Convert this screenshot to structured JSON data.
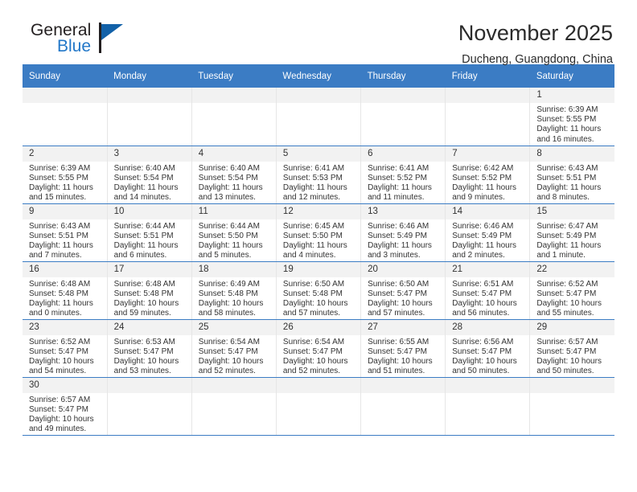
{
  "brand": {
    "name_top": "General",
    "name_bottom": "Blue",
    "flag_icon": "blue-triangle-flag-icon",
    "accent_color": "#2277c8"
  },
  "header": {
    "title": "November 2025",
    "subtitle": "Ducheng, Guangdong, China"
  },
  "theme": {
    "header_blue": "#3b7cc4",
    "row_border_blue": "#3b7cc4",
    "daynum_bg": "#f2f2f2"
  },
  "calendar": {
    "weekday_headers": [
      "Sunday",
      "Monday",
      "Tuesday",
      "Wednesday",
      "Thursday",
      "Friday",
      "Saturday"
    ],
    "weeks": [
      [
        {
          "day": ""
        },
        {
          "day": ""
        },
        {
          "day": ""
        },
        {
          "day": ""
        },
        {
          "day": ""
        },
        {
          "day": ""
        },
        {
          "day": "1",
          "sunrise": "Sunrise: 6:39 AM",
          "sunset": "Sunset: 5:55 PM",
          "daylight": "Daylight: 11 hours and 16 minutes."
        }
      ],
      [
        {
          "day": "2",
          "sunrise": "Sunrise: 6:39 AM",
          "sunset": "Sunset: 5:55 PM",
          "daylight": "Daylight: 11 hours and 15 minutes."
        },
        {
          "day": "3",
          "sunrise": "Sunrise: 6:40 AM",
          "sunset": "Sunset: 5:54 PM",
          "daylight": "Daylight: 11 hours and 14 minutes."
        },
        {
          "day": "4",
          "sunrise": "Sunrise: 6:40 AM",
          "sunset": "Sunset: 5:54 PM",
          "daylight": "Daylight: 11 hours and 13 minutes."
        },
        {
          "day": "5",
          "sunrise": "Sunrise: 6:41 AM",
          "sunset": "Sunset: 5:53 PM",
          "daylight": "Daylight: 11 hours and 12 minutes."
        },
        {
          "day": "6",
          "sunrise": "Sunrise: 6:41 AM",
          "sunset": "Sunset: 5:52 PM",
          "daylight": "Daylight: 11 hours and 11 minutes."
        },
        {
          "day": "7",
          "sunrise": "Sunrise: 6:42 AM",
          "sunset": "Sunset: 5:52 PM",
          "daylight": "Daylight: 11 hours and 9 minutes."
        },
        {
          "day": "8",
          "sunrise": "Sunrise: 6:43 AM",
          "sunset": "Sunset: 5:51 PM",
          "daylight": "Daylight: 11 hours and 8 minutes."
        }
      ],
      [
        {
          "day": "9",
          "sunrise": "Sunrise: 6:43 AM",
          "sunset": "Sunset: 5:51 PM",
          "daylight": "Daylight: 11 hours and 7 minutes."
        },
        {
          "day": "10",
          "sunrise": "Sunrise: 6:44 AM",
          "sunset": "Sunset: 5:51 PM",
          "daylight": "Daylight: 11 hours and 6 minutes."
        },
        {
          "day": "11",
          "sunrise": "Sunrise: 6:44 AM",
          "sunset": "Sunset: 5:50 PM",
          "daylight": "Daylight: 11 hours and 5 minutes."
        },
        {
          "day": "12",
          "sunrise": "Sunrise: 6:45 AM",
          "sunset": "Sunset: 5:50 PM",
          "daylight": "Daylight: 11 hours and 4 minutes."
        },
        {
          "day": "13",
          "sunrise": "Sunrise: 6:46 AM",
          "sunset": "Sunset: 5:49 PM",
          "daylight": "Daylight: 11 hours and 3 minutes."
        },
        {
          "day": "14",
          "sunrise": "Sunrise: 6:46 AM",
          "sunset": "Sunset: 5:49 PM",
          "daylight": "Daylight: 11 hours and 2 minutes."
        },
        {
          "day": "15",
          "sunrise": "Sunrise: 6:47 AM",
          "sunset": "Sunset: 5:49 PM",
          "daylight": "Daylight: 11 hours and 1 minute."
        }
      ],
      [
        {
          "day": "16",
          "sunrise": "Sunrise: 6:48 AM",
          "sunset": "Sunset: 5:48 PM",
          "daylight": "Daylight: 11 hours and 0 minutes."
        },
        {
          "day": "17",
          "sunrise": "Sunrise: 6:48 AM",
          "sunset": "Sunset: 5:48 PM",
          "daylight": "Daylight: 10 hours and 59 minutes."
        },
        {
          "day": "18",
          "sunrise": "Sunrise: 6:49 AM",
          "sunset": "Sunset: 5:48 PM",
          "daylight": "Daylight: 10 hours and 58 minutes."
        },
        {
          "day": "19",
          "sunrise": "Sunrise: 6:50 AM",
          "sunset": "Sunset: 5:48 PM",
          "daylight": "Daylight: 10 hours and 57 minutes."
        },
        {
          "day": "20",
          "sunrise": "Sunrise: 6:50 AM",
          "sunset": "Sunset: 5:47 PM",
          "daylight": "Daylight: 10 hours and 57 minutes."
        },
        {
          "day": "21",
          "sunrise": "Sunrise: 6:51 AM",
          "sunset": "Sunset: 5:47 PM",
          "daylight": "Daylight: 10 hours and 56 minutes."
        },
        {
          "day": "22",
          "sunrise": "Sunrise: 6:52 AM",
          "sunset": "Sunset: 5:47 PM",
          "daylight": "Daylight: 10 hours and 55 minutes."
        }
      ],
      [
        {
          "day": "23",
          "sunrise": "Sunrise: 6:52 AM",
          "sunset": "Sunset: 5:47 PM",
          "daylight": "Daylight: 10 hours and 54 minutes."
        },
        {
          "day": "24",
          "sunrise": "Sunrise: 6:53 AM",
          "sunset": "Sunset: 5:47 PM",
          "daylight": "Daylight: 10 hours and 53 minutes."
        },
        {
          "day": "25",
          "sunrise": "Sunrise: 6:54 AM",
          "sunset": "Sunset: 5:47 PM",
          "daylight": "Daylight: 10 hours and 52 minutes."
        },
        {
          "day": "26",
          "sunrise": "Sunrise: 6:54 AM",
          "sunset": "Sunset: 5:47 PM",
          "daylight": "Daylight: 10 hours and 52 minutes."
        },
        {
          "day": "27",
          "sunrise": "Sunrise: 6:55 AM",
          "sunset": "Sunset: 5:47 PM",
          "daylight": "Daylight: 10 hours and 51 minutes."
        },
        {
          "day": "28",
          "sunrise": "Sunrise: 6:56 AM",
          "sunset": "Sunset: 5:47 PM",
          "daylight": "Daylight: 10 hours and 50 minutes."
        },
        {
          "day": "29",
          "sunrise": "Sunrise: 6:57 AM",
          "sunset": "Sunset: 5:47 PM",
          "daylight": "Daylight: 10 hours and 50 minutes."
        }
      ],
      [
        {
          "day": "30",
          "sunrise": "Sunrise: 6:57 AM",
          "sunset": "Sunset: 5:47 PM",
          "daylight": "Daylight: 10 hours and 49 minutes."
        },
        {
          "day": ""
        },
        {
          "day": ""
        },
        {
          "day": ""
        },
        {
          "day": ""
        },
        {
          "day": ""
        },
        {
          "day": ""
        }
      ]
    ]
  }
}
